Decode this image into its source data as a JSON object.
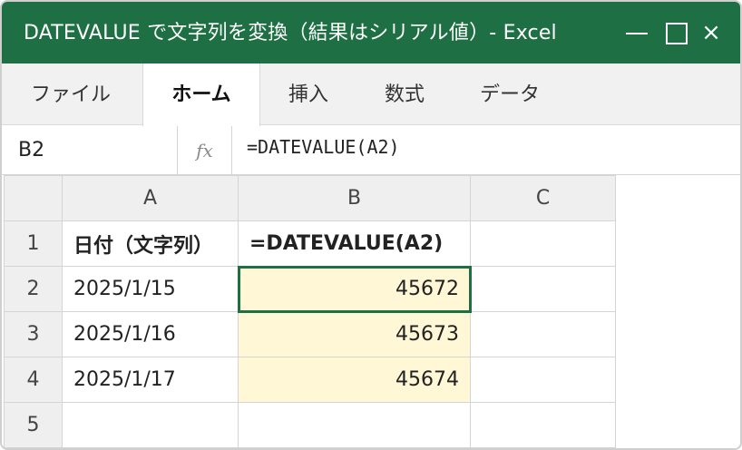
{
  "window": {
    "title": "DATEVALUE で文字列を変換（結果はシリアル値）- Excel"
  },
  "ribbon": {
    "tabs": [
      {
        "label": "ファイル",
        "active": false
      },
      {
        "label": "ホーム",
        "active": true
      },
      {
        "label": "挿入",
        "active": false
      },
      {
        "label": "数式",
        "active": false
      },
      {
        "label": "データ",
        "active": false
      }
    ]
  },
  "formula_bar": {
    "name_box": "B2",
    "fx_label": "fx",
    "formula": "=DATEVALUE(A2)"
  },
  "sheet": {
    "columns": [
      "A",
      "B",
      "C"
    ],
    "rows": [
      {
        "row": "1",
        "a": "日付（文字列）",
        "b": "=DATEVALUE(A2)",
        "c": ""
      },
      {
        "row": "2",
        "a": "2025/1/15",
        "b": "45672",
        "c": ""
      },
      {
        "row": "3",
        "a": "2025/1/16",
        "b": "45673",
        "c": ""
      },
      {
        "row": "4",
        "a": "2025/1/17",
        "b": "45674",
        "c": ""
      },
      {
        "row": "5",
        "a": "",
        "b": "",
        "c": ""
      }
    ],
    "selected_cell": "B2",
    "colors": {
      "accent": "#1e6f43",
      "result_fill": "#fff7d6"
    }
  }
}
